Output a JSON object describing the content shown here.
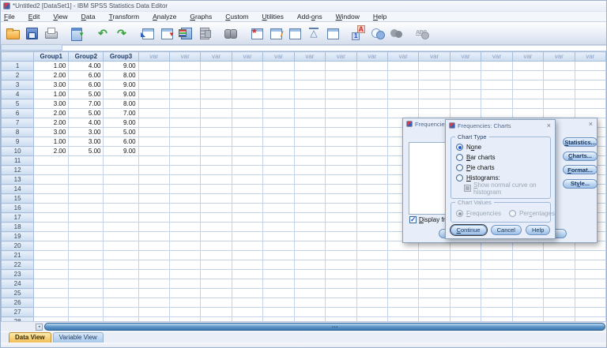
{
  "window": {
    "title": "*Untitled2 [DataSet1] - IBM SPSS Statistics Data Editor"
  },
  "menu": {
    "items": [
      {
        "label": "File",
        "accel": 0
      },
      {
        "label": "Edit",
        "accel": 0
      },
      {
        "label": "View",
        "accel": 0
      },
      {
        "label": "Data",
        "accel": 0
      },
      {
        "label": "Transform",
        "accel": 0
      },
      {
        "label": "Analyze",
        "accel": 0
      },
      {
        "label": "Graphs",
        "accel": 0
      },
      {
        "label": "Custom",
        "accel": 0
      },
      {
        "label": "Utilities",
        "accel": 0
      },
      {
        "label": "Add-ons",
        "accel": 4
      },
      {
        "label": "Window",
        "accel": 0
      },
      {
        "label": "Help",
        "accel": 0
      }
    ]
  },
  "toolbar": {
    "icons": [
      {
        "name": "open-file-icon",
        "icon": "open",
        "gap": false
      },
      {
        "name": "save-icon",
        "icon": "save",
        "gap": false
      },
      {
        "name": "print-icon",
        "icon": "print",
        "gap": false
      },
      {
        "name": "recall-dialogs-icon",
        "icon": "recall",
        "gap": true
      },
      {
        "name": "undo-icon",
        "icon": "undo",
        "gap": true
      },
      {
        "name": "redo-icon",
        "icon": "redo",
        "gap": false
      },
      {
        "name": "goto-case-icon",
        "icon": "gotocase",
        "gap": true
      },
      {
        "name": "goto-variable-icon",
        "icon": "gotovar",
        "gap": false
      },
      {
        "name": "variables-icon",
        "icon": "variables",
        "gap": false
      },
      {
        "name": "run-descriptives-icon",
        "icon": "proc",
        "gap": false
      },
      {
        "name": "find-icon",
        "icon": "find",
        "gap": true
      },
      {
        "name": "insert-cases-icon",
        "icon": "insertcase",
        "gap": true
      },
      {
        "name": "insert-variable-icon",
        "icon": "insertvar",
        "gap": false
      },
      {
        "name": "split-file-icon",
        "icon": "split",
        "gap": false
      },
      {
        "name": "weight-cases-icon",
        "icon": "weight",
        "gap": false
      },
      {
        "name": "select-cases-icon",
        "icon": "select",
        "gap": false
      },
      {
        "name": "value-labels-icon",
        "icon": "valuelabels",
        "gap": true
      },
      {
        "name": "use-variable-sets-icon",
        "icon": "sets",
        "gap": false
      },
      {
        "name": "show-all-variables-icon",
        "icon": "circles",
        "gap": false
      },
      {
        "name": "spell-check-icon",
        "icon": "spell",
        "gap": true
      }
    ]
  },
  "grid": {
    "columns": [
      "Group1",
      "Group2",
      "Group3"
    ],
    "var_label": "var",
    "var_count": 15,
    "row_count": 28,
    "rows": [
      [
        "1.00",
        "4.00",
        "9.00"
      ],
      [
        "2.00",
        "6.00",
        "8.00"
      ],
      [
        "3.00",
        "6.00",
        "9.00"
      ],
      [
        "1.00",
        "5.00",
        "9.00"
      ],
      [
        "3.00",
        "7.00",
        "8.00"
      ],
      [
        "2.00",
        "5.00",
        "7.00"
      ],
      [
        "2.00",
        "4.00",
        "9.00"
      ],
      [
        "3.00",
        "3.00",
        "5.00"
      ],
      [
        "1.00",
        "3.00",
        "6.00"
      ],
      [
        "2.00",
        "5.00",
        "9.00"
      ]
    ]
  },
  "tabs": {
    "data_view": "Data View",
    "variable_view": "Variable View"
  },
  "back_dialog": {
    "title": "Frequencies",
    "close_label": "×",
    "display_checkbox": {
      "label": "Display frequency tables",
      "accel": 0,
      "checked": true
    },
    "side_buttons": [
      {
        "label": "Statistics...",
        "accel": 0
      },
      {
        "label": "Charts...",
        "accel": 0
      },
      {
        "label": "Format...",
        "accel": 0
      },
      {
        "label": "Style...",
        "accel": 2
      }
    ]
  },
  "front_dialog": {
    "title": "Frequencies: Charts",
    "close_label": "×",
    "chart_type": {
      "legend": "Chart Type",
      "options": [
        {
          "label": "None",
          "accel": 1,
          "selected": true
        },
        {
          "label": "Bar charts",
          "accel": 0,
          "selected": false
        },
        {
          "label": "Pie charts",
          "accel": 0,
          "selected": false
        },
        {
          "label": "Histograms:",
          "accel": 0,
          "selected": false
        }
      ],
      "sub_checkbox": {
        "label": "Show normal curve on histogram",
        "accel": 0,
        "checked": false,
        "disabled": true
      }
    },
    "chart_values": {
      "legend": "Chart Values",
      "options": [
        {
          "label": "Frequencies",
          "accel": 0,
          "selected": true,
          "disabled": true
        },
        {
          "label": "Percentages",
          "accel": 3,
          "selected": false,
          "disabled": true
        }
      ]
    },
    "buttons": [
      {
        "label": "Continue",
        "accel": 0,
        "default": true
      },
      {
        "label": "Cancel",
        "accel": -1,
        "default": false
      },
      {
        "label": "Help",
        "accel": -1,
        "default": false
      }
    ]
  },
  "colors": {
    "accent_blue": "#2a66c8",
    "dialog_bg": "#e7eef9",
    "grid_line": "#c3d4ea",
    "tab_active": "#f2bd55",
    "scrollbar": "#5b93c6"
  }
}
